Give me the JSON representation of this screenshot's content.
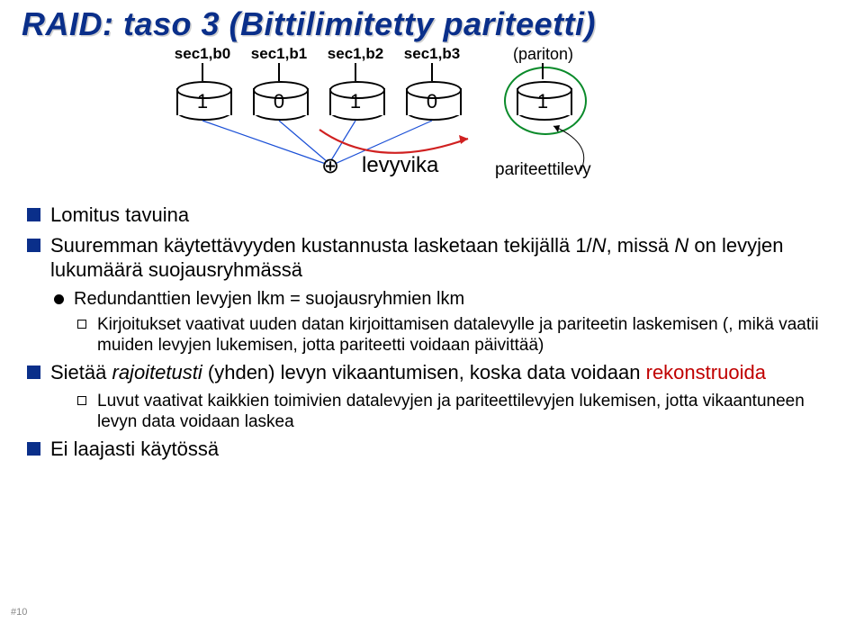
{
  "title": "RAID: taso 3 (Bittilimitetty pariteetti)",
  "diagram": {
    "sec_labels": [
      "sec1,b0",
      "sec1,b1",
      "sec1,b2",
      "sec1,b3"
    ],
    "values": [
      "1",
      "0",
      "1",
      "0",
      "1"
    ],
    "xor_symbol": "⊕",
    "levyvika": "levyvika",
    "pariteettilevy": "pariteettilevy",
    "pariton": "(pariton)"
  },
  "bullets": {
    "lomitus": "Lomitus tavuina",
    "suuremman_pre": "Suuremman käytettävyyden kustannusta lasketaan tekijällä 1/",
    "suuremman_n1": "N",
    "suuremman_mid": ", missä ",
    "suuremman_n2": "N",
    "suuremman_post": " on levyjen lukumäärä suojausryhmässä",
    "redund": "Redundanttien levyjen lkm = suojausryhmien lkm",
    "kirjoitukset": "Kirjoitukset vaativat uuden datan kirjoittamisen datalevylle ja pariteetin laskemisen (, mikä vaatii muiden levyjen lukemisen, jotta pariteetti voidaan päivittää)",
    "sietaa_pre": "Sietää ",
    "sietaa_ital": "rajoitetusti",
    "sietaa_mid": " (yhden) levyn vikaantumisen, koska data voidaan ",
    "sietaa_red": "rekonstruoida",
    "luvut": "Luvut vaativat kaikkien toimivien datalevyjen ja pariteettilevyjen lukemisen, jotta vikaantuneen levyn data voidaan laskea",
    "ei": "Ei laajasti käytössä"
  },
  "slide_num": "#10"
}
